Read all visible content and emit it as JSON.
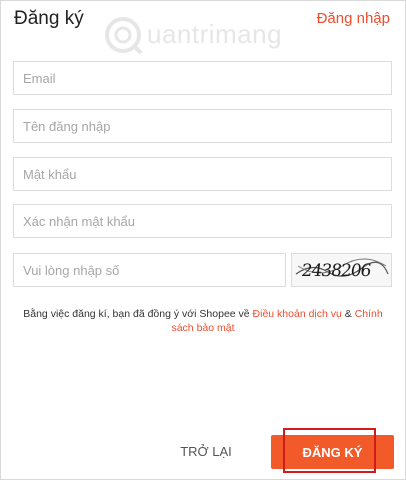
{
  "header": {
    "title": "Đăng ký",
    "login_link": "Đăng nhập"
  },
  "watermark": {
    "text": "uantrimang",
    "icon": "watermark-logo-icon"
  },
  "form": {
    "email_placeholder": "Email",
    "username_placeholder": "Tên đăng nhập",
    "password_placeholder": "Mật khẩu",
    "confirm_placeholder": "Xác nhận mật khẩu",
    "captcha_placeholder": "Vui lòng nhập số",
    "captcha_text": "2438206"
  },
  "terms": {
    "prefix": "Bằng việc đăng kí, bạn đã đồng ý với Shopee về ",
    "terms_link": "Điều khoản dịch vụ",
    "connector": " & ",
    "privacy_link": "Chính sách bảo mật"
  },
  "actions": {
    "back_label": "TRỞ LẠI",
    "submit_label": "ĐĂNG KÝ"
  },
  "colors": {
    "accent": "#ee4d2d",
    "button": "#f25a2a",
    "highlight": "#d21c1c"
  }
}
